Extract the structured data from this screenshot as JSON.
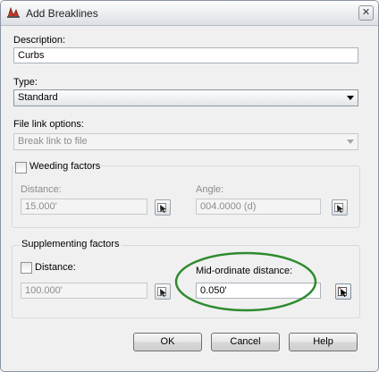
{
  "window": {
    "title": "Add Breaklines",
    "close_glyph": "✕"
  },
  "description": {
    "label": "Description:",
    "value": "Curbs"
  },
  "type": {
    "label": "Type:",
    "value": "Standard"
  },
  "file_link": {
    "label": "File link options:",
    "value": "Break link to file"
  },
  "weeding": {
    "label": "Weeding factors",
    "checked": false,
    "distance_label": "Distance:",
    "distance_value": "15.000'",
    "angle_label": "Angle:",
    "angle_value": "004.0000 (d)"
  },
  "supplementing": {
    "label": "Supplementing factors",
    "distance_label": "Distance:",
    "distance_checked": false,
    "distance_value": "100.000'",
    "midordinate_label": "Mid-ordinate distance:",
    "midordinate_value": "0.050'"
  },
  "buttons": {
    "ok": "OK",
    "cancel": "Cancel",
    "help": "Help"
  },
  "icons": {
    "app": "civil3d-app-icon",
    "pick": "pick-in-drawing-icon",
    "close": "close-icon",
    "dropdown": "chevron-down-icon"
  },
  "colors": {
    "highlight_ellipse": "#2e8b2e"
  }
}
